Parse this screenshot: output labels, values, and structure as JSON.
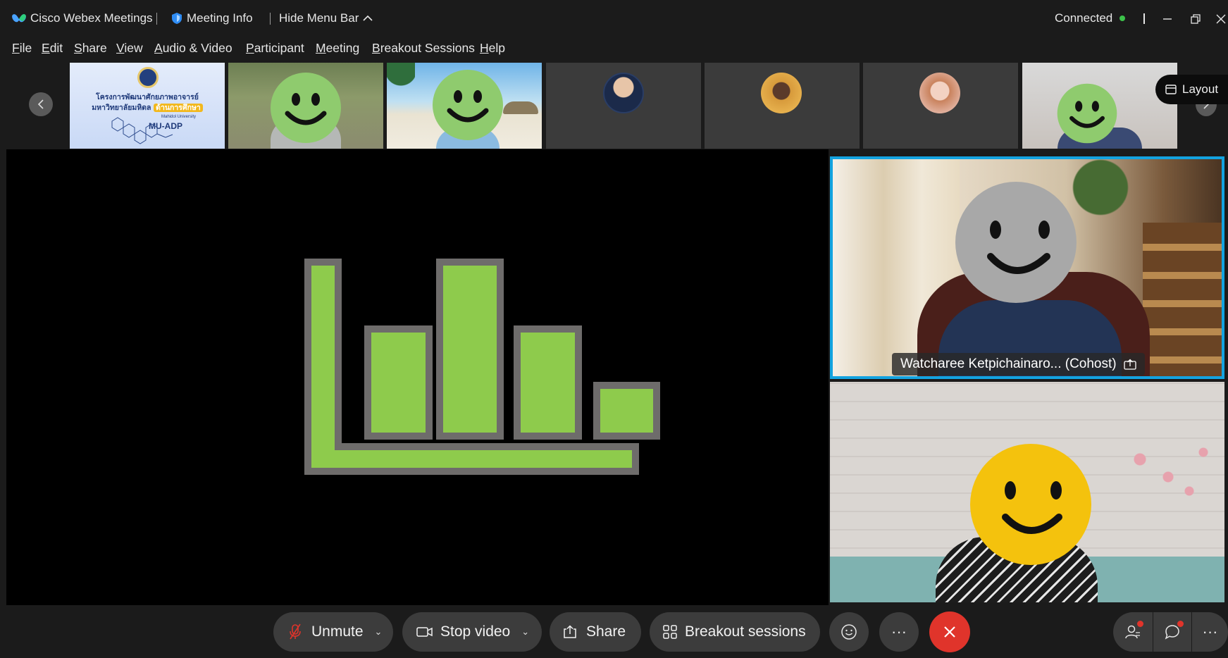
{
  "titlebar": {
    "app_name": "Cisco Webex Meetings",
    "meeting_info": "Meeting Info",
    "hide_menu_bar": "Hide Menu Bar",
    "status": "Connected",
    "status_color": "#3cc24a"
  },
  "menu": [
    {
      "label": "File",
      "accel": "F",
      "rest": "ile"
    },
    {
      "label": "Edit",
      "accel": "E",
      "rest": "dit"
    },
    {
      "label": "Share",
      "accel": "S",
      "rest": "hare"
    },
    {
      "label": "View",
      "accel": "V",
      "rest": "iew"
    },
    {
      "label": "Audio & Video",
      "accel": "A",
      "rest": "udio & Video"
    },
    {
      "label": "Participant",
      "accel": "P",
      "rest": "articipant"
    },
    {
      "label": "Meeting",
      "accel": "M",
      "rest": "eeting"
    },
    {
      "label": "Breakout Sessions",
      "accel": "B",
      "rest": "reakout Sessions"
    },
    {
      "label": "Help",
      "accel": "H",
      "rest": "elp"
    }
  ],
  "strip": {
    "slide": {
      "line1": "โครงการพัฒนาศักยภาพอาจารย์",
      "line2": "มหาวิทยาลัยมหิดล",
      "highlight": "ด้านการศึกษา",
      "uni": "Mahidol University",
      "program": "MU-ADP"
    },
    "layout_label": "Layout"
  },
  "speaker": {
    "name": "Watcharee Ketpichainaro... (Cohost)"
  },
  "toolbar": {
    "unmute": "Unmute",
    "stop_video": "Stop video",
    "share": "Share",
    "breakout": "Breakout sessions",
    "more": "···",
    "leave_color": "#e0342b"
  },
  "colors": {
    "accent": "#13a3e0",
    "chart_green": "#8ecb4c",
    "chart_border": "#6e6c6b"
  }
}
